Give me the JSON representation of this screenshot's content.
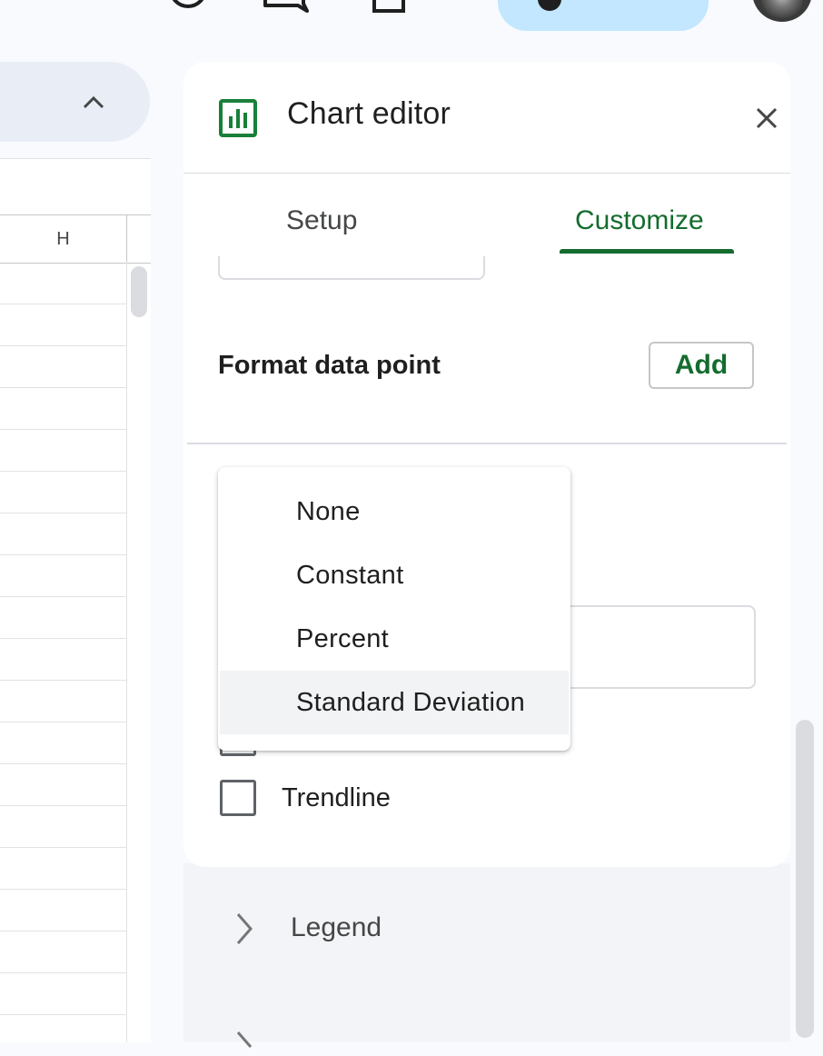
{
  "toolbar": {
    "icons": [
      "history-icon",
      "comment-icon",
      "video-call-icon",
      "share-globe-icon",
      "account-avatar"
    ],
    "share_button_color": "#c2e7ff"
  },
  "sheet": {
    "column_header": "H",
    "name_box_bg": "#e9eef6"
  },
  "chart_editor": {
    "title": "Chart editor",
    "tabs": [
      {
        "label": "Setup",
        "active": false
      },
      {
        "label": "Customize",
        "active": true
      }
    ],
    "accent_color": "#146c2e",
    "format_data_point": {
      "label": "Format data point",
      "add_label": "Add"
    },
    "error_bars_dropdown": {
      "options": [
        "None",
        "Constant",
        "Percent",
        "Standard Deviation"
      ],
      "hovered": "Standard Deviation"
    },
    "trendline": {
      "label": "Trendline",
      "checked": false
    },
    "sections": [
      {
        "label": "Legend",
        "expanded": false
      }
    ]
  }
}
